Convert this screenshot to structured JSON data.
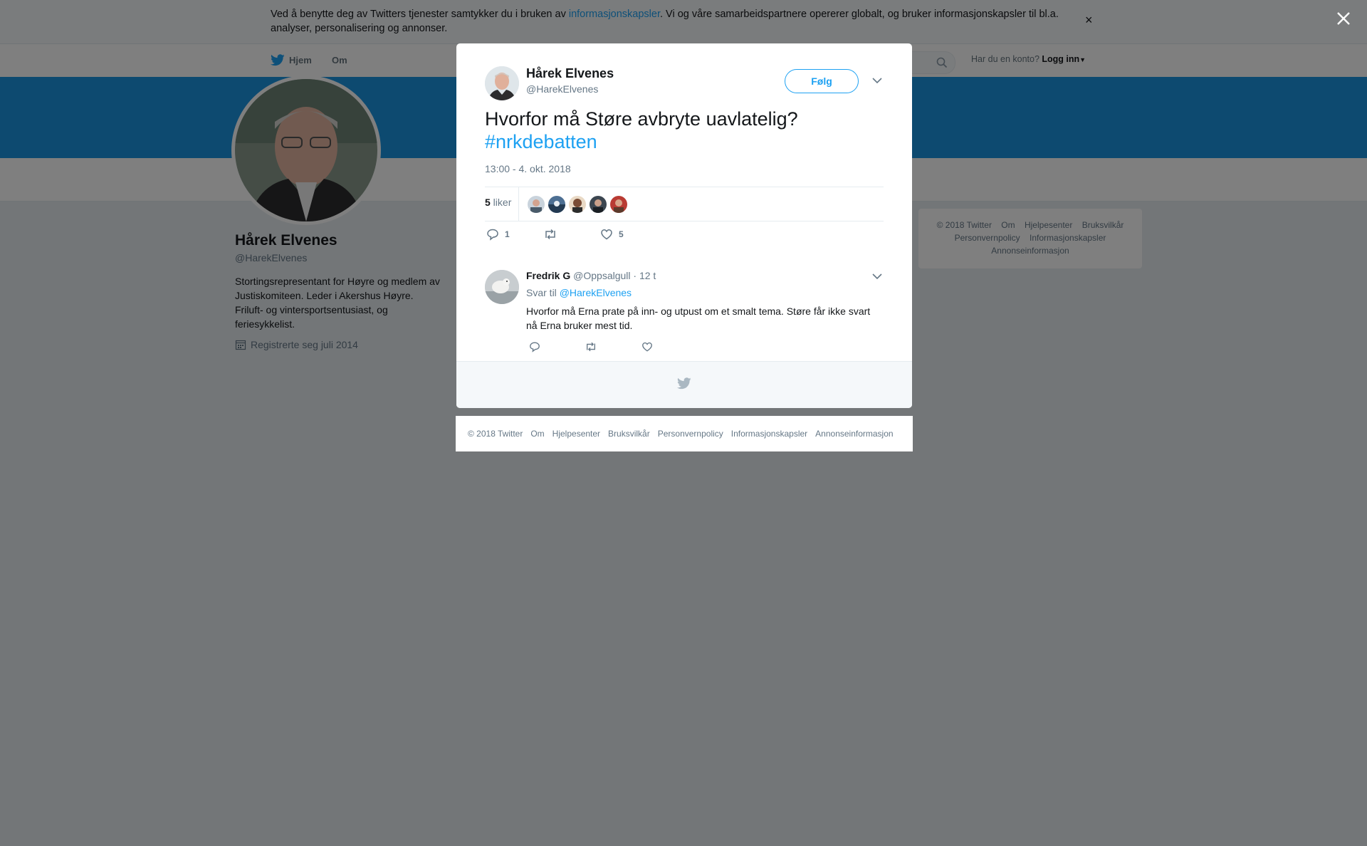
{
  "cookie_banner": {
    "text_before": "Ved å benytte deg av Twitters tjenester samtykker du i bruken av ",
    "link": "informasjonskapsler",
    "text_after": ". Vi og våre samarbeidspartnere opererer globalt, og bruker informasjonskapsler til bl.a. analyser, personalisering og annonser.",
    "close": "×"
  },
  "topnav": {
    "home": "Hjem",
    "about": "Om",
    "login_prompt": "Har du en konto?",
    "login": "Logg inn"
  },
  "profile": {
    "name": "Hårek Elvenes",
    "handle": "@HarekElvenes",
    "bio": "Stortingsrepresentant for Høyre og medlem av Justiskomiteen. Leder i Akershus Høyre. Friluft- og vintersportsentusiast, og feriesykkelist.",
    "joined": "Registrerte seg juli 2014"
  },
  "side_footer": {
    "items": [
      "© 2018 Twitter",
      "Om",
      "Hjelpesenter",
      "Bruksvilkår",
      "Personvernpolicy",
      "Informasjonskapsler",
      "Annonseinformasjon"
    ]
  },
  "tweet": {
    "author_name": "Hårek Elvenes",
    "author_handle": "@HarekElvenes",
    "follow_label": "Følg",
    "text": "Hvorfor må Støre avbryte uavlatelig? ",
    "hashtag": "#nrkdebatten",
    "timestamp": "13:00 - 4. okt. 2018",
    "likes_number": "5",
    "likes_word": " liker",
    "reply_count": "1",
    "retweet_count": "",
    "like_count": "5"
  },
  "reply": {
    "name": "Fredrik G",
    "handle": "@Oppsalgull",
    "dot": "·",
    "time": "12 t",
    "reply_to_prefix": "Svar til ",
    "reply_to_handle": "@HarekElvenes",
    "text": "Hvorfor må Erna prate på inn- og utpust om et smalt tema. Støre får ikke svart nå Erna bruker mest tid."
  },
  "bottom_footer": {
    "items": [
      "© 2018 Twitter",
      "Om",
      "Hjelpesenter",
      "Bruksvilkår",
      "Personvernpolicy",
      "Informasjonskapsler",
      "Annonseinformasjon"
    ]
  },
  "colors": {
    "brand_blue": "#1da1f2",
    "header_blue": "#1b95e0",
    "overlay": "rgba(0,0,0,0.5)"
  },
  "icons": [
    "twitter-bird-icon",
    "search-icon",
    "calendar-icon",
    "close-icon",
    "chevron-down-icon",
    "reply-icon",
    "retweet-icon",
    "heart-icon"
  ]
}
